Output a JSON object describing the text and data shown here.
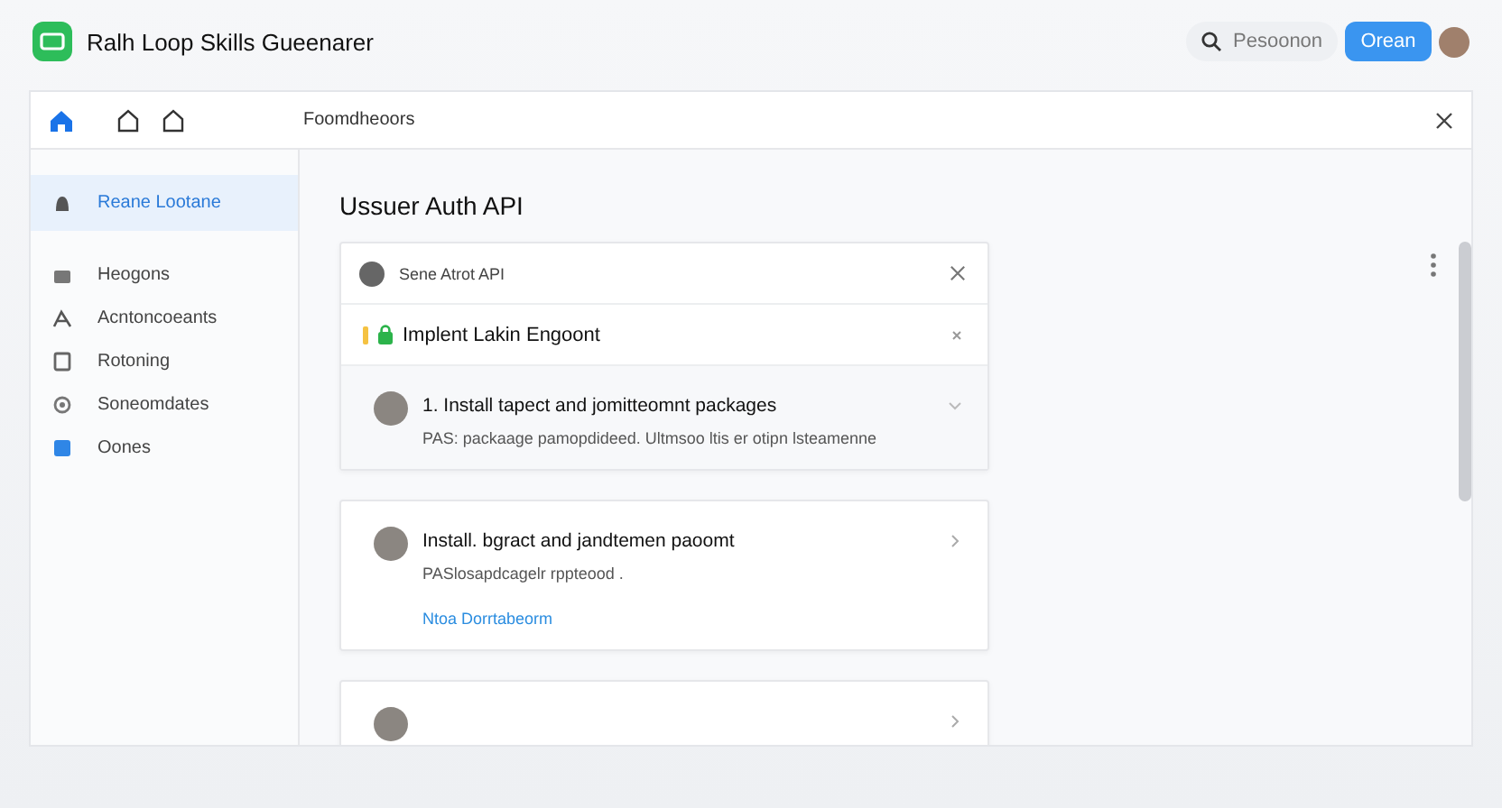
{
  "app": {
    "title": "Ralh Loop Skills Gueenarer",
    "search": {
      "placeholder": "Pesoonon"
    },
    "primary_button": "Orean"
  },
  "toolbar": {
    "breadcrumb": "Foomdheoors"
  },
  "sidebar": {
    "items": [
      {
        "label": "Reane Lootane",
        "selected": true
      },
      {
        "label": "Heogons",
        "selected": false
      },
      {
        "label": "Acntoncoeants",
        "selected": false
      },
      {
        "label": "Rotoning",
        "selected": false
      },
      {
        "label": "Soneomdates",
        "selected": false
      },
      {
        "label": "Oones",
        "selected": false
      }
    ]
  },
  "content": {
    "title": "Ussuer Auth API",
    "cards": [
      {
        "header": "Sene Atrot API",
        "task": "Implent Lakin Engoont",
        "steps": [
          {
            "title": "1. Install tapect and jomitteomnt packages",
            "detail": "PAS: packaage pamopdideed. Ultmsoo ltis er otipn lsteamenne",
            "expanded": true
          }
        ]
      },
      {
        "steps": [
          {
            "title": "Install. bgract and jandtemen paoomt",
            "detail": "PASlosapdcagelr rppteood .",
            "link": "Ntoa Dorrtabeorm",
            "expanded": false
          }
        ]
      },
      {
        "steps": [
          {
            "expanded": false
          }
        ]
      }
    ]
  }
}
